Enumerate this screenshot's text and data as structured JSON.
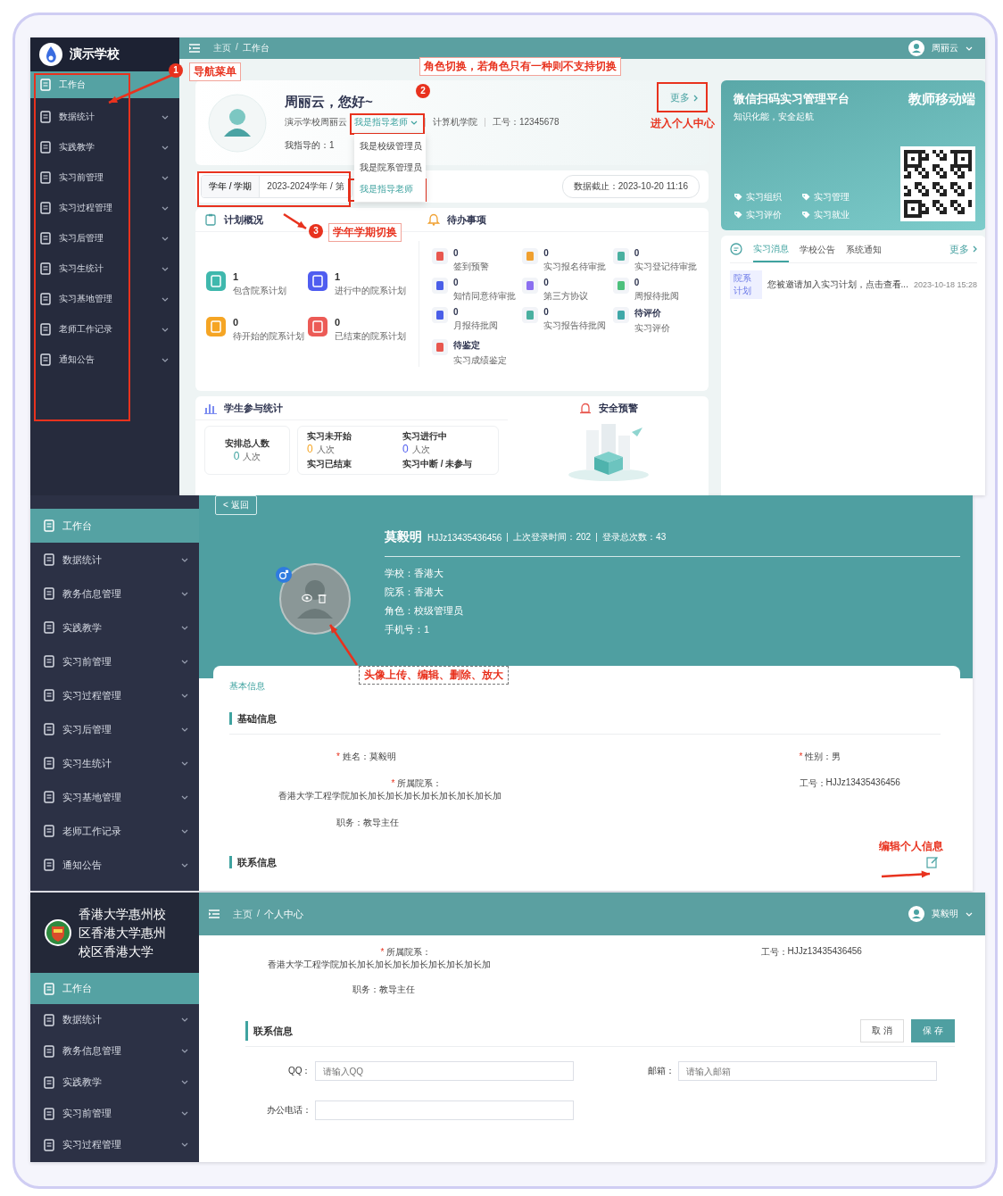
{
  "workbench": {
    "school": "演示学校",
    "breadcrumb": [
      "主页",
      "工作台"
    ],
    "breadcrumb_separator": "/",
    "user": "周丽云",
    "nav": [
      {
        "label": "工作台",
        "selected": true,
        "expandable": false
      },
      {
        "label": "数据统计",
        "selected": false,
        "expandable": true
      },
      {
        "label": "实践教学",
        "selected": false,
        "expandable": true
      },
      {
        "label": "实习前管理",
        "selected": false,
        "expandable": true
      },
      {
        "label": "实习过程管理",
        "selected": false,
        "expandable": true
      },
      {
        "label": "实习后管理",
        "selected": false,
        "expandable": true
      },
      {
        "label": "实习生统计",
        "selected": false,
        "expandable": true
      },
      {
        "label": "实习基地管理",
        "selected": false,
        "expandable": true
      },
      {
        "label": "老师工作记录",
        "selected": false,
        "expandable": true
      },
      {
        "label": "通知公告",
        "selected": false,
        "expandable": true
      }
    ],
    "greeting": "周丽云，您好~",
    "org": "演示学校周丽云",
    "role": "我是指导老师",
    "college": "计算机学院",
    "staff_no": "工号：12345678",
    "guided": "我指导的：1",
    "more": "更多",
    "role_options": [
      {
        "label": "我是校级管理员",
        "selected": false
      },
      {
        "label": "我是院系管理员",
        "selected": false
      },
      {
        "label": "我是指导老师",
        "selected": true
      }
    ],
    "term_label": "学年 / 学期",
    "term_value": "2023-2024学年 / 第",
    "data_as_of": "数据截止：2023-10-20 11:16",
    "plan_title": "计划概况",
    "plans": [
      {
        "value": "1",
        "label": "包含院系计划",
        "color": "#3fb8ad"
      },
      {
        "value": "1",
        "label": "进行中的院系计划",
        "color": "#4f5df0"
      },
      {
        "value": "0",
        "label": "待开始的院系计划",
        "color": "#f5a524"
      },
      {
        "value": "0",
        "label": "已结束的院系计划",
        "color": "#ec5b56"
      }
    ],
    "todo_title": "待办事项",
    "todos": [
      {
        "value": "0",
        "label": "签到预警",
        "color": "#e8574f"
      },
      {
        "value": "0",
        "label": "实习报名待审批",
        "color": "#f0a030"
      },
      {
        "value": "0",
        "label": "实习登记待审批",
        "color": "#4ab0a0"
      },
      {
        "value": "0",
        "label": "知情同意待审批",
        "color": "#4a5ee8"
      },
      {
        "value": "0",
        "label": "第三方协议",
        "color": "#8b6ff0"
      },
      {
        "value": "0",
        "label": "周报待批阅",
        "color": "#4cc07c"
      },
      {
        "value": "0",
        "label": "月报待批阅",
        "color": "#4a5ee8"
      },
      {
        "value": "0",
        "label": "实习报告待批阅",
        "color": "#4ab0a0"
      },
      {
        "value": "待评价",
        "label": "实习评价",
        "color": "#3fa8a8"
      },
      {
        "value": "待鉴定",
        "label": "实习成绩鉴定",
        "color": "#e8574f"
      }
    ],
    "stats_title": "学生参与统计",
    "total_label": "安排总人数",
    "total_value": "0",
    "unit": "人次",
    "stats": [
      {
        "label": "实习未开始",
        "value": "0",
        "unit": "人次",
        "color": "#f5a524"
      },
      {
        "label": "实习进行中",
        "value": "0",
        "unit": "人次",
        "color": "#4f5df0"
      },
      {
        "label": "实习已结束"
      },
      {
        "label": "实习中断 / 未参与"
      }
    ],
    "safety_title": "安全预警",
    "promo": {
      "title": "微信扫码实习管理平台",
      "subtitle": "知识化能，安全起航",
      "badge": "教师移动端",
      "tags": [
        "实习组织",
        "实习管理",
        "实习评价",
        "实习就业"
      ]
    },
    "message_tabs": [
      {
        "label": "实习消息",
        "selected": true
      },
      {
        "label": "学校公告",
        "selected": false
      },
      {
        "label": "系统通知",
        "selected": false
      }
    ],
    "message_more": "更多",
    "messages": [
      {
        "tag": "院系计划",
        "text": "您被邀请加入实习计划，点击查看...",
        "time": "2023-10-18 15:28"
      }
    ]
  },
  "profile": {
    "nav": [
      {
        "label": "工作台",
        "selected": true,
        "expandable": false
      },
      {
        "label": "数据统计",
        "selected": false,
        "expandable": true
      },
      {
        "label": "教务信息管理",
        "selected": false,
        "expandable": true
      },
      {
        "label": "实践教学",
        "selected": false,
        "expandable": true
      },
      {
        "label": "实习前管理",
        "selected": false,
        "expandable": true
      },
      {
        "label": "实习过程管理",
        "selected": false,
        "expandable": true
      },
      {
        "label": "实习后管理",
        "selected": false,
        "expandable": true
      },
      {
        "label": "实习生统计",
        "selected": false,
        "expandable": true
      },
      {
        "label": "实习基地管理",
        "selected": false,
        "expandable": true
      },
      {
        "label": "老师工作记录",
        "selected": false,
        "expandable": true
      },
      {
        "label": "通知公告",
        "selected": false,
        "expandable": true
      }
    ],
    "back": "< 返回",
    "name": "莫毅明",
    "id": "HJJz13435436456",
    "last_login": "上次登录时间：202",
    "login_count": "登录总次数：43",
    "details": [
      "学校：香港大",
      "院系：香港大",
      "角色：校级管理员",
      "手机号：1"
    ],
    "tab": "基本信息",
    "basic_title": "基础信息",
    "required_mark": "*",
    "fields": [
      {
        "label": "姓名：",
        "value": "莫毅明",
        "required": true
      },
      {
        "label": "性别：",
        "value": "男",
        "required": true
      },
      {
        "label": "所属院系：",
        "value": "香港大学工程学院加长加长加长加长加长加长加长加长加",
        "required": true
      },
      {
        "label": "工号：",
        "value": "HJJz13435436456",
        "required": false
      },
      {
        "label": "职务：",
        "value": "教导主任",
        "required": false
      }
    ],
    "contact_title": "联系信息"
  },
  "profile_edit": {
    "school": "香港大学惠州校区香港大学惠州校区香港大学",
    "breadcrumb": [
      "主页",
      "个人中心"
    ],
    "breadcrumb_separator": "/",
    "user": "莫毅明",
    "required_mark": "*",
    "nav": [
      {
        "label": "工作台",
        "selected": true,
        "expandable": false
      },
      {
        "label": "数据统计",
        "selected": false,
        "expandable": true
      },
      {
        "label": "教务信息管理",
        "selected": false,
        "expandable": true
      },
      {
        "label": "实践教学",
        "selected": false,
        "expandable": true
      },
      {
        "label": "实习前管理",
        "selected": false,
        "expandable": true
      },
      {
        "label": "实习过程管理",
        "selected": false,
        "expandable": true
      }
    ],
    "fields": [
      {
        "label": "所属院系：",
        "value": "香港大学工程学院加长加长加长加长加长加长加长加长加",
        "required": true
      },
      {
        "label": "工号：",
        "value": "HJJz13435436456",
        "required": false
      },
      {
        "label": "职务：",
        "value": "教导主任",
        "required": false
      }
    ],
    "contact_title": "联系信息",
    "cancel": "取 消",
    "save": "保 存",
    "inputs": [
      {
        "label": "QQ：",
        "placeholder": "请输入QQ"
      },
      {
        "label": "邮箱：",
        "placeholder": "请输入邮箱"
      },
      {
        "label": "办公电话："
      }
    ]
  },
  "callouts": [
    {
      "kind": "numbered",
      "number": "1",
      "text": "导航菜单"
    },
    {
      "kind": "numbered",
      "number": "2",
      "text": "角色切换，若角色只有一种则不支持切换"
    },
    {
      "kind": "plain",
      "text": "进入个人中心"
    },
    {
      "kind": "numbered",
      "number": "3",
      "text": "学年学期切换"
    },
    {
      "kind": "dashed",
      "text": "头像上传、编辑、删除、放大"
    },
    {
      "kind": "plain",
      "text": "编辑个人信息"
    }
  ]
}
